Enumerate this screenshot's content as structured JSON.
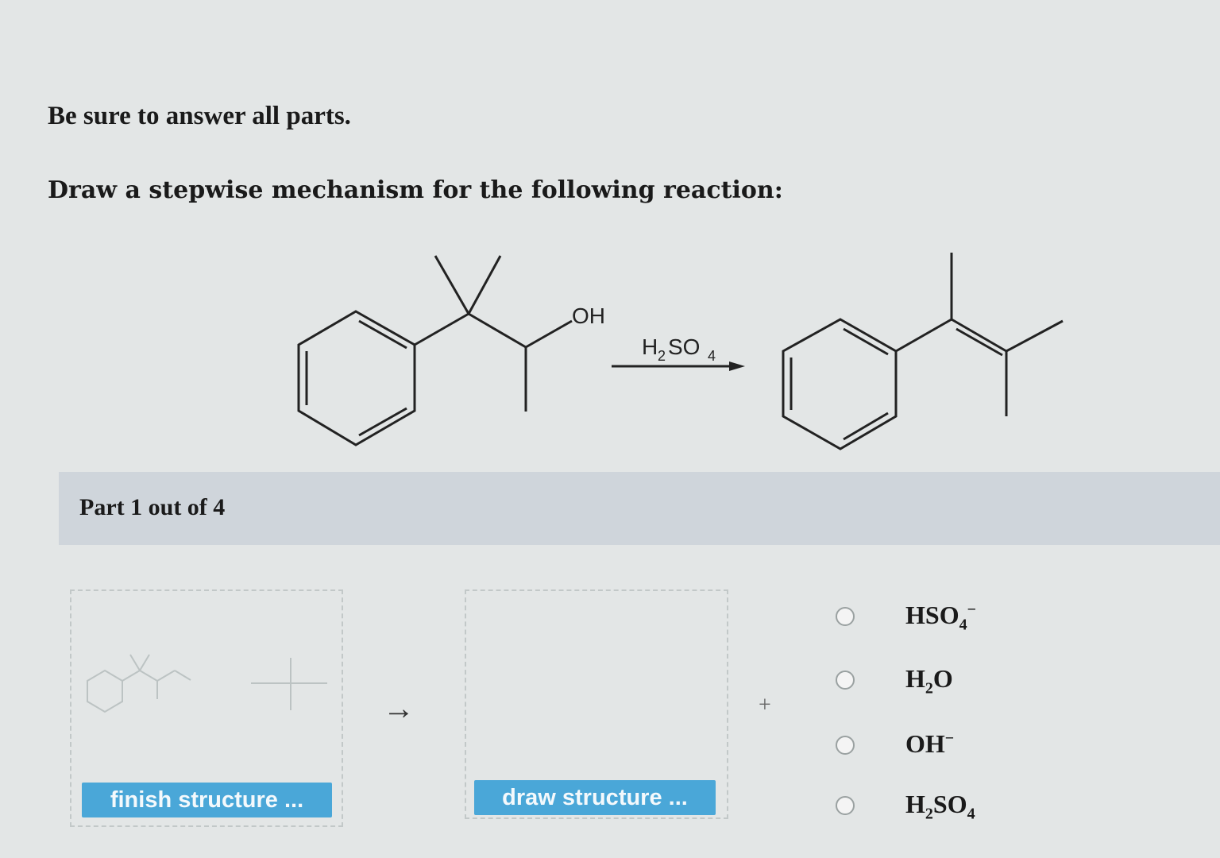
{
  "instructions": {
    "line1": "Be sure to answer all parts.",
    "line2": "Draw a stepwise mechanism for the following reaction:"
  },
  "reaction": {
    "reactant_label": "OH",
    "reagent_main": "H",
    "reagent_sub1": "2",
    "reagent_mid": "SO",
    "reagent_sub2": "4"
  },
  "part": {
    "label": "Part 1 out of 4"
  },
  "buttons": {
    "finish": "finish structure ...",
    "draw": "draw structure ..."
  },
  "symbols": {
    "arrow": "→",
    "plus": "+"
  },
  "options": [
    {
      "main": "HSO",
      "sub": "4",
      "sup": "−"
    },
    {
      "main": "H",
      "sub": "2",
      "tail": "O"
    },
    {
      "main": "OH",
      "sup": "−"
    },
    {
      "main": "H",
      "sub": "2",
      "tail": "SO",
      "sub2": "4"
    }
  ]
}
